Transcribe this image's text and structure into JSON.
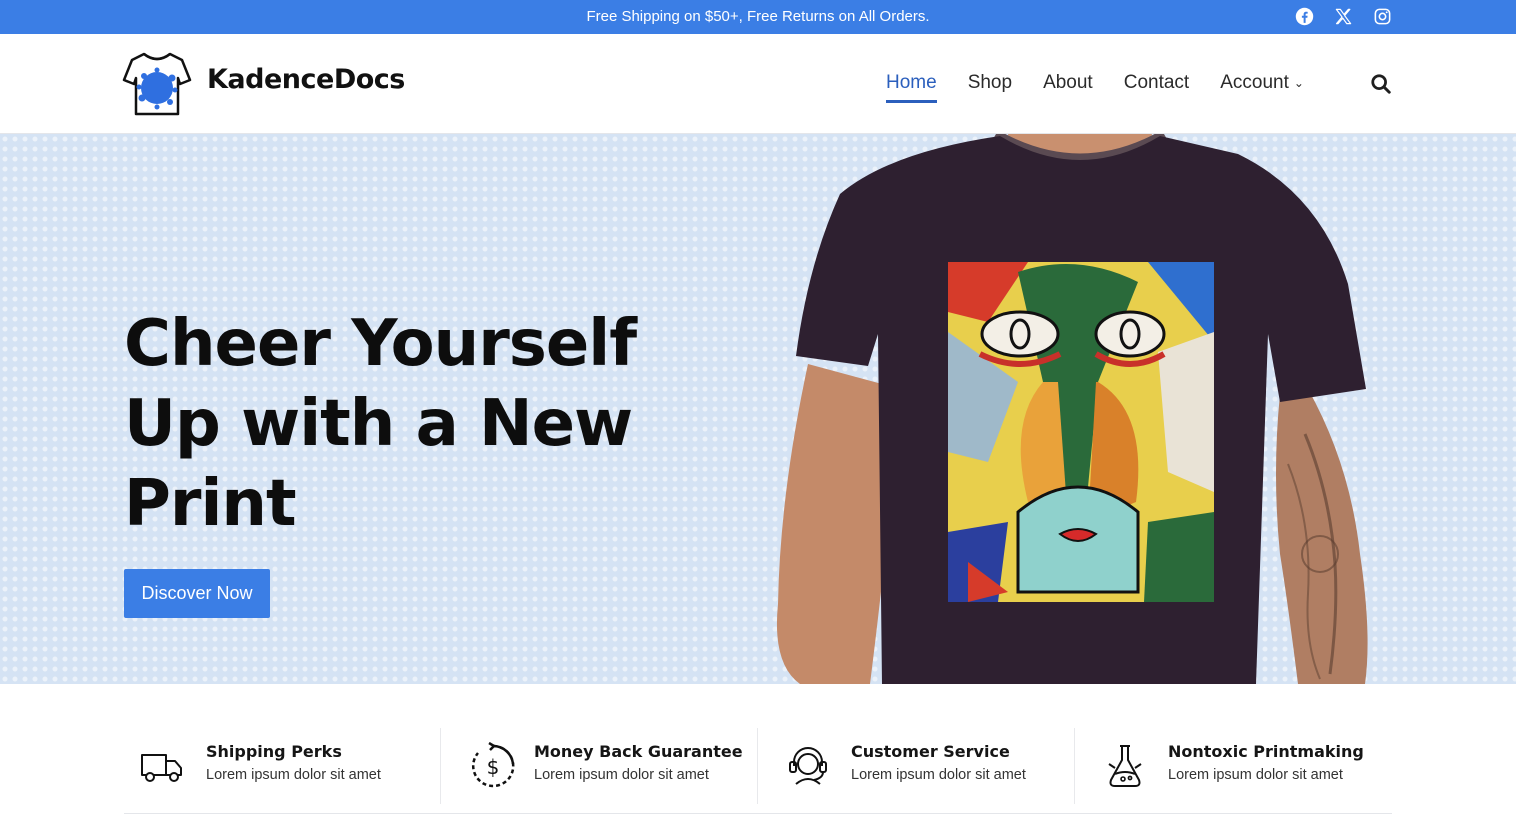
{
  "topbar": {
    "promo": "Free Shipping on $50+, Free Returns on All Orders.",
    "social": [
      "facebook-icon",
      "x-icon",
      "instagram-icon"
    ],
    "background": "#3b7ee5"
  },
  "header": {
    "brand": "KadenceDocs",
    "nav": [
      {
        "label": "Home",
        "active": true
      },
      {
        "label": "Shop",
        "active": false
      },
      {
        "label": "About",
        "active": false
      },
      {
        "label": "Contact",
        "active": false
      },
      {
        "label": "Account",
        "active": false,
        "has_dropdown": true
      }
    ],
    "accent": "#2b5fbd",
    "search_icon": "search-icon"
  },
  "hero": {
    "title": "Cheer Yourself Up with a New Print",
    "button_label": "Discover Now",
    "button_color": "#3b7ee5",
    "image": "model-wearing-abstract-face-print-tshirt"
  },
  "features": [
    {
      "icon": "delivery-truck-icon",
      "title": "Shipping Perks",
      "desc": "Lorem ipsum dolor sit amet"
    },
    {
      "icon": "money-back-icon",
      "title": "Money Back Guarantee",
      "desc": "Lorem ipsum dolor sit amet"
    },
    {
      "icon": "headset-support-icon",
      "title": "Customer Service",
      "desc": "Lorem ipsum dolor sit amet"
    },
    {
      "icon": "flask-icon",
      "title": "Nontoxic Printmaking",
      "desc": "Lorem ipsum dolor sit amet"
    }
  ]
}
